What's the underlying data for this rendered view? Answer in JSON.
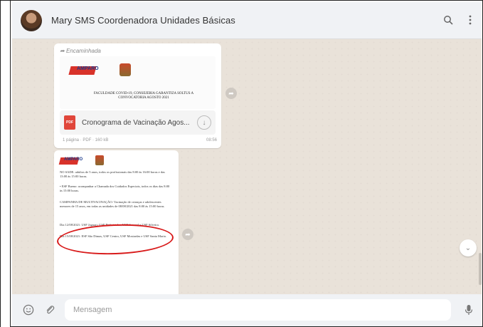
{
  "header": {
    "contact_name": "Mary SMS Coordenadora Unidades Básicas"
  },
  "message1": {
    "forwarded_label": "Encaminhada",
    "doc_logo_text": "AMPARO",
    "doc_header_caps": "FACULDADE COVID-19, CONSEJERIA GARANTIZA SOLTUS A CONVOCATORIA AGOSTO 2021",
    "file_name": "Cronograma de Vacinação Agos...",
    "file_meta": "1 página · PDF · 160 kB",
    "time": "08:56"
  },
  "message2": {
    "logo_text": "AMPARO",
    "para1": "NO SADE: adultos de 5 anos, todos os profissionais das 8:00 às 16:00 horas e das 13:00 às 15:00 horas.",
    "para2": "• ESF Bueno: acompanhar a Chamada dos Cuidados Especiais, todos os dias das 8:00 às 15:00 horas.",
    "para3": "CAMPANHA DE MULTIVACINAÇÃO: Vacinação de crianças e adolescentes menores de 15 anos, em todas as unidades de 08/08/2021 das 8:00 às 15:00 horas.",
    "para4": "Dia 12/08/2021: USF Jaguari, USF Pinheirinho, USF Caracol e USF Silveira.",
    "para5": "Dia 15/08/2021: ESF São Dimas, USF Centro, USF Mostardas e USF Santa Maria."
  },
  "composer": {
    "placeholder": "Mensagem"
  },
  "icons": {
    "search": "search-icon",
    "menu": "more-vert-icon",
    "emoji": "emoji-icon",
    "attach": "paperclip-icon",
    "mic": "microphone-icon",
    "share": "share-icon",
    "download": "download-icon",
    "scroll_down": "chevron-down-icon"
  },
  "colors": {
    "chat_bg": "#e9e2d9",
    "header_bg": "#f0f2f5",
    "oval_red": "#d81a1a",
    "pdf_red": "#e0463a"
  }
}
